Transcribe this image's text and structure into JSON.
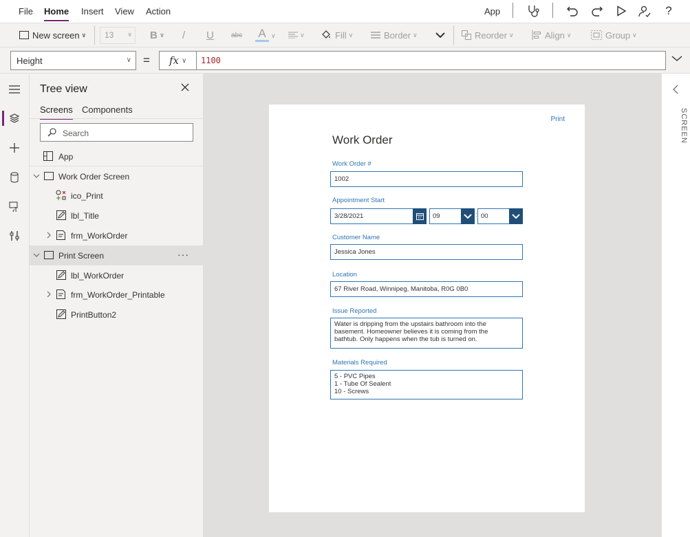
{
  "menubar": {
    "items": [
      "File",
      "Home",
      "Insert",
      "View",
      "Action"
    ],
    "active": "Home",
    "app_label": "App",
    "icons": [
      "app-checker-icon",
      "undo-icon",
      "redo-icon",
      "play-icon",
      "share-icon",
      "help-icon"
    ]
  },
  "ribbon": {
    "new_screen": "New screen",
    "font_size": "13",
    "fill": "Fill",
    "border": "Border",
    "reorder": "Reorder",
    "align": "Align",
    "group": "Group",
    "bold": "B",
    "italic": "/",
    "underline": "U",
    "strike": "abc",
    "font_color": "A"
  },
  "formula": {
    "property": "Height",
    "equals": "=",
    "fx": "fx",
    "value": "1100"
  },
  "tree": {
    "title": "Tree view",
    "tabs": [
      "Screens",
      "Components"
    ],
    "active_tab": "Screens",
    "search_placeholder": "Search",
    "items": [
      {
        "label": "App",
        "level": 0,
        "icon": "app-icon"
      },
      {
        "label": "Work Order Screen",
        "level": 0,
        "icon": "screen-icon",
        "expanded": true
      },
      {
        "label": "ico_Print",
        "level": 1,
        "icon": "icon-control-icon"
      },
      {
        "label": "lbl_Title",
        "level": 1,
        "icon": "label-edit-icon"
      },
      {
        "label": "frm_WorkOrder",
        "level": 1,
        "icon": "form-icon",
        "collapsed": true
      },
      {
        "label": "Print Screen",
        "level": 0,
        "icon": "screen-icon",
        "expanded": true,
        "selected": true
      },
      {
        "label": "lbl_WorkOrder",
        "level": 1,
        "icon": "label-edit-icon"
      },
      {
        "label": "frm_WorkOrder_Printable",
        "level": 1,
        "icon": "form-icon",
        "collapsed": true
      },
      {
        "label": "PrintButton2",
        "level": 1,
        "icon": "label-edit-icon"
      }
    ],
    "more": "···"
  },
  "canvas": {
    "print_link": "Print",
    "title": "Work Order",
    "fields": {
      "work_order_label": "Work Order #",
      "work_order_value": "1002",
      "appointment_label": "Appointment Start",
      "date_value": "3/28/2021",
      "hour_value": "09",
      "minute_value": "00",
      "time_sep": ":",
      "customer_label": "Customer Name",
      "customer_value": "Jessica Jones",
      "location_label": "Location",
      "location_value": "67 River Road, Winnipeg, Manitoba, R0G 0B0",
      "issue_label": "Issue Reported",
      "issue_value": "Water is dripping from the upstairs bathroom into the basement.  Homeowner believes it is coming from the bathtub.  Only happens when the tub is turned on.",
      "materials_label": "Materials Required",
      "materials_value": "5 - PVC Pipes\n1 - Tube Of Sealent\n10 - Screws"
    }
  },
  "rightpanel": {
    "label": "SCREEN"
  },
  "colors": {
    "accent": "#742774",
    "field_border": "#2e74b5",
    "dropdown_button": "#1f4e79"
  }
}
